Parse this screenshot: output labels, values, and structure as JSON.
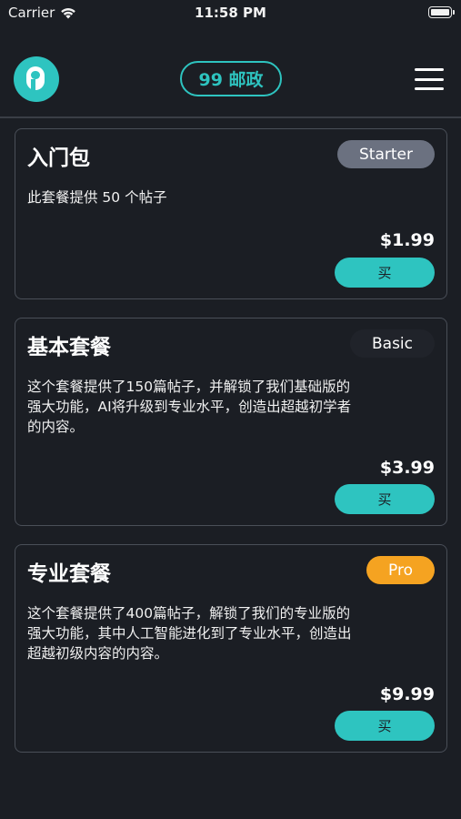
{
  "status_bar": {
    "carrier": "Carrier",
    "time": "11:58 PM"
  },
  "header": {
    "logo_icon": "p-logo-icon",
    "credits_label": "99 邮政",
    "menu_icon": "hamburger-menu-icon"
  },
  "colors": {
    "accent": "#2ec4c0",
    "background": "#1b1e24",
    "badge_starter": "#6b7180",
    "badge_pro": "#f5a321"
  },
  "plans": [
    {
      "title": "入门包",
      "badge": "Starter",
      "description": "此套餐提供 50 个帖子",
      "price": "$1.99",
      "buy_label": "买"
    },
    {
      "title": "基本套餐",
      "badge": "Basic",
      "description": "这个套餐提供了150篇帖子，并解锁了我们基础版的强大功能，AI将升级到专业水平，创造出超越初学者的内容。",
      "price": "$3.99",
      "buy_label": "买"
    },
    {
      "title": "专业套餐",
      "badge": "Pro",
      "description": "这个套餐提供了400篇帖子，解锁了我们的专业版的强大功能，其中人工智能进化到了专业水平，创造出超越初级内容的内容。",
      "price": "$9.99",
      "buy_label": "买"
    }
  ]
}
